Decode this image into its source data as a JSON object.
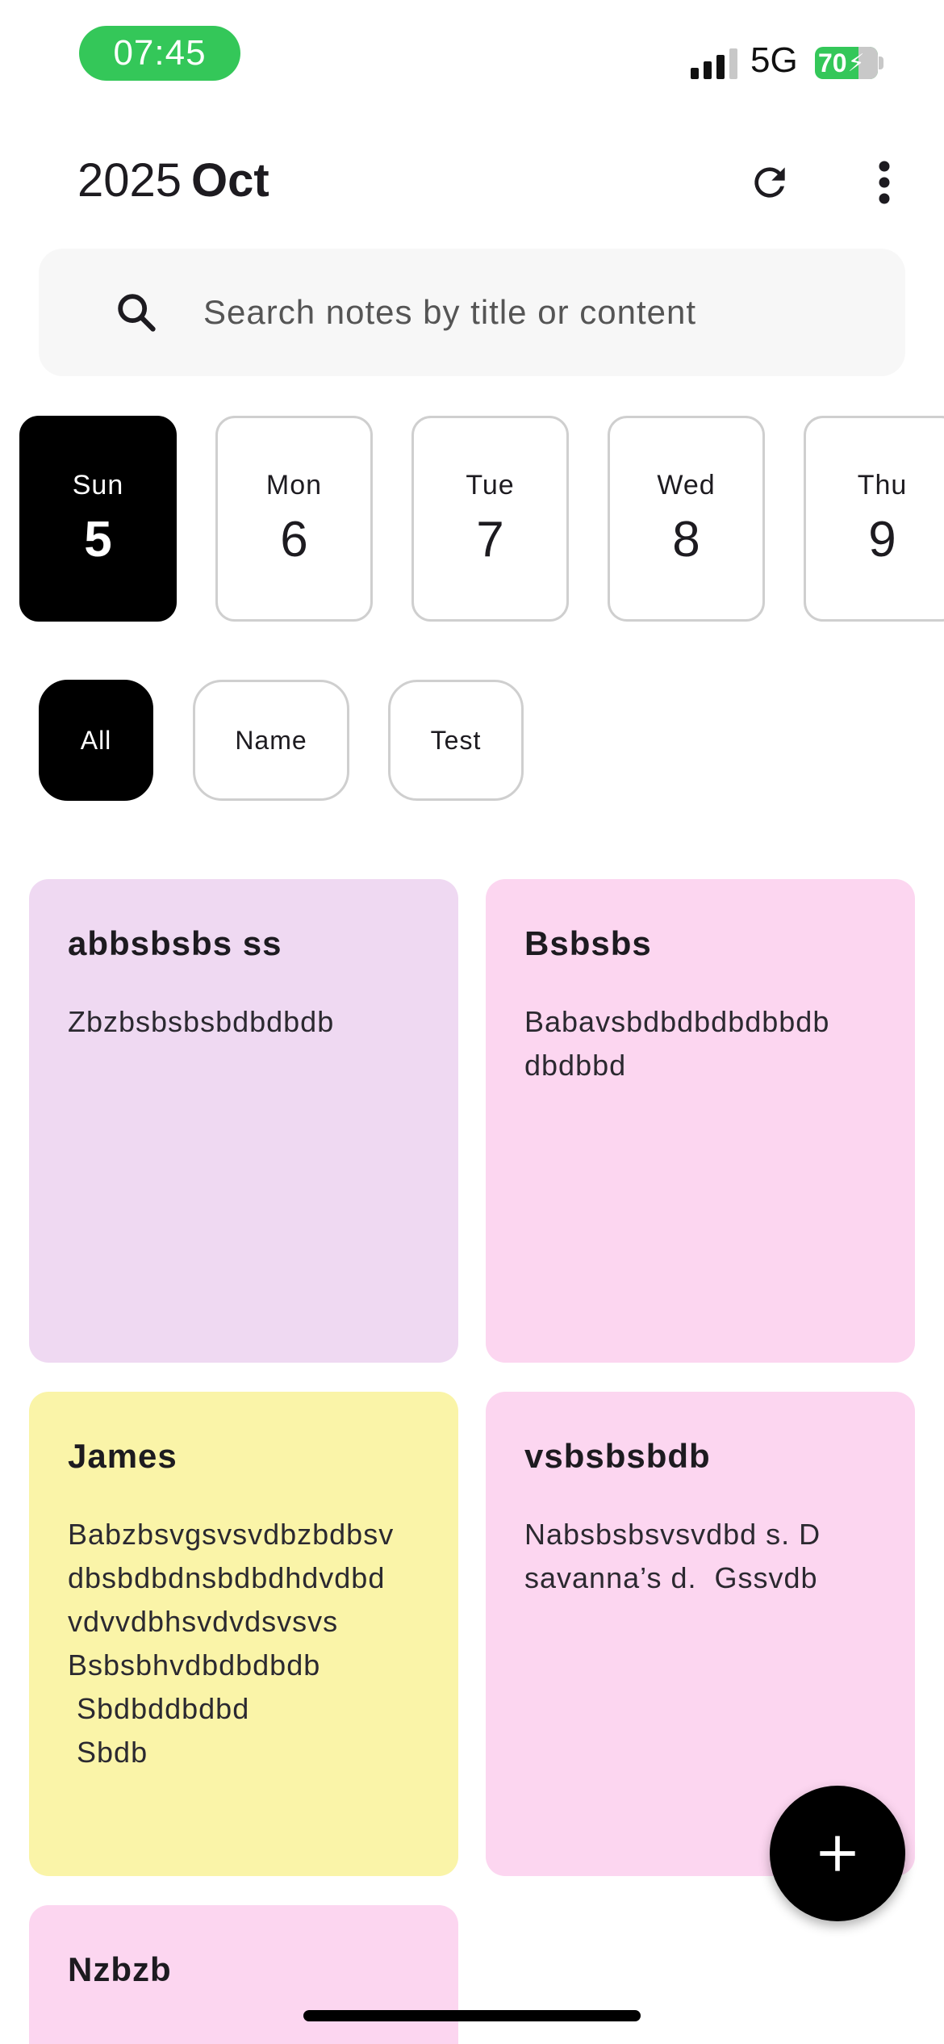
{
  "status_bar": {
    "time": "07:45",
    "network": "5G",
    "battery_level": "70",
    "battery_color": "#34c759"
  },
  "header": {
    "year": "2025",
    "month": "Oct",
    "refresh_icon": "refresh-icon",
    "menu_icon": "more-vertical-icon"
  },
  "search": {
    "placeholder": "Search notes by title or content",
    "value": "",
    "icon": "search-icon"
  },
  "days": [
    {
      "name": "Sun",
      "num": "5",
      "selected": true
    },
    {
      "name": "Mon",
      "num": "6",
      "selected": false
    },
    {
      "name": "Tue",
      "num": "7",
      "selected": false
    },
    {
      "name": "Wed",
      "num": "8",
      "selected": false
    },
    {
      "name": "Thu",
      "num": "9",
      "selected": false
    }
  ],
  "filters": [
    {
      "label": "All",
      "selected": true
    },
    {
      "label": "Name",
      "selected": false
    },
    {
      "label": "Test",
      "selected": false
    }
  ],
  "notes": [
    {
      "title": "abbsbsbs ss",
      "body": "Zbzbsbsbsbdbdbdb",
      "color": "#efd9f2"
    },
    {
      "title": "Bsbsbs",
      "body": "Babavsbdbdbdbdbbdb\ndbdbbd",
      "color": "#fcd6f0"
    },
    {
      "title": "James",
      "body": "Babzbsvgsvsvdbzbdbsv\ndbsbdbdnsbdbdhdvdbd\nvdvvdbhsvdvdsvsvs\nBsbsbhvdbdbdbdb\n Sbdbddbdbd\n Sbdb",
      "color": "#faf4a8"
    },
    {
      "title": "vsbsbsbdb",
      "body": "Nabsbsbsvsvdbd s. D\nsavanna’s d.  Gssvdb",
      "color": "#fcd6f0"
    },
    {
      "title": "Nzbzb",
      "body": "",
      "color": "#fcd6f0"
    }
  ],
  "fab": {
    "icon": "plus-icon"
  },
  "colors": {
    "accent": "#000000",
    "chip_border": "#cfcfcf",
    "search_bg": "#f7f7f7"
  }
}
